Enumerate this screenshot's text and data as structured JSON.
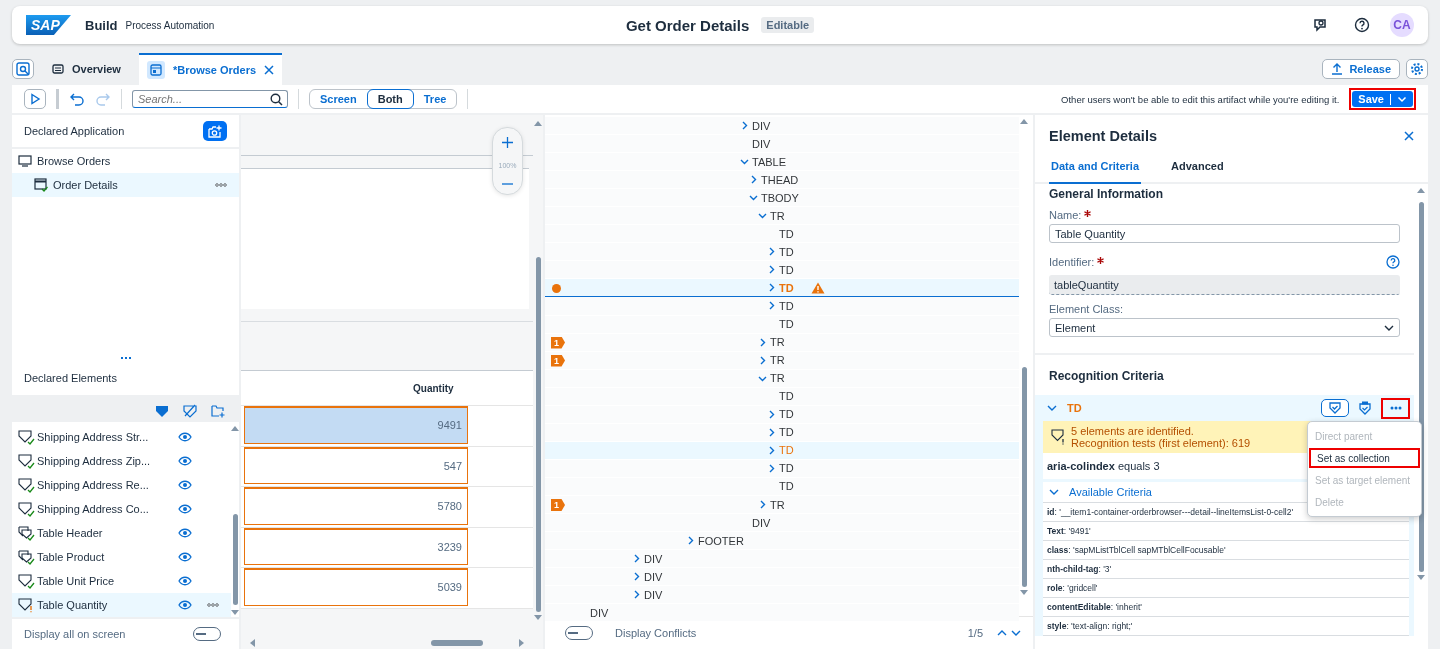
{
  "header": {
    "logo": "SAP",
    "product": "Build",
    "subtitle": "Process Automation",
    "title": "Get Order Details",
    "badge": "Editable",
    "avatar": "CA"
  },
  "tabs": [
    {
      "label": "Overview",
      "selected": false,
      "closable": false
    },
    {
      "label": "*Browse Orders",
      "selected": true,
      "closable": true
    }
  ],
  "release_button": "Release",
  "toolbar": {
    "search": {
      "placeholder": "Search..."
    },
    "redo_disabled": true,
    "views": [
      {
        "label": "Screen",
        "selected": false
      },
      {
        "label": "Both",
        "selected": true
      },
      {
        "label": "Tree",
        "selected": false
      }
    ],
    "notice": "Other users won't be able to edit this artifact while you're editing it.",
    "save": {
      "label": "Save",
      "annotated": true
    }
  },
  "declared_application": {
    "title": "Declared Application",
    "items": [
      {
        "label": "Browse Orders",
        "selected": false,
        "children": [
          {
            "label": "Order Details",
            "selected": true
          }
        ]
      }
    ]
  },
  "declared_elements": {
    "title": "Declared Elements",
    "items": [
      {
        "label": "Shipping Address Str...",
        "kind": "element",
        "recognized": true,
        "selected": false
      },
      {
        "label": "Shipping Address Zip...",
        "kind": "element",
        "recognized": true,
        "selected": false
      },
      {
        "label": "Shipping Address Re...",
        "kind": "element",
        "recognized": true,
        "selected": false
      },
      {
        "label": "Shipping Address Co...",
        "kind": "element",
        "recognized": true,
        "selected": false
      },
      {
        "label": "Table Header",
        "kind": "collection",
        "recognized": true,
        "selected": false
      },
      {
        "label": "Table Product",
        "kind": "collection",
        "recognized": true,
        "selected": false
      },
      {
        "label": "Table Unit Price",
        "kind": "element",
        "recognized": true,
        "selected": false
      },
      {
        "label": "Table Quantity",
        "kind": "element",
        "recognized": false,
        "selected": true
      }
    ],
    "display_all": {
      "label": "Display all on screen",
      "on": false
    }
  },
  "screen_preview": {
    "zoom": "100%",
    "column": "Quantity",
    "cells": [
      {
        "value": "9491",
        "selected": true
      },
      {
        "value": "547",
        "selected": false
      },
      {
        "value": "5780",
        "selected": false
      },
      {
        "value": "3239",
        "selected": false
      },
      {
        "value": "5039",
        "selected": false
      }
    ]
  },
  "dom_tree": {
    "nodes": [
      {
        "children": [
          {
            "children": [
              {
                "children": [
                  {
                    "label": "DIV",
                    "kind": "branch",
                    "expanded": false
                  },
                  {
                    "label": "DIV",
                    "kind": "leaf"
                  },
                  {
                    "label": "TABLE",
                    "kind": "branch",
                    "expanded": true,
                    "children": [
                      {
                        "label": "THEAD",
                        "kind": "branch",
                        "expanded": false
                      },
                      {
                        "label": "TBODY",
                        "kind": "branch",
                        "expanded": true,
                        "children": [
                          {
                            "label": "TR",
                            "kind": "branch",
                            "expanded": true,
                            "children": [
                              {
                                "label": "TD",
                                "kind": "leaf"
                              },
                              {
                                "label": "TD",
                                "kind": "branch",
                                "expanded": false
                              },
                              {
                                "label": "TD",
                                "kind": "branch",
                                "expanded": false
                              },
                              {
                                "label": "TD",
                                "kind": "branch",
                                "expanded": false,
                                "selected": true,
                                "conflict": true,
                                "warning": true
                              },
                              {
                                "label": "TD",
                                "kind": "branch",
                                "expanded": false
                              },
                              {
                                "label": "TD",
                                "kind": "leaf"
                              }
                            ]
                          },
                          {
                            "label": "TR",
                            "kind": "branch",
                            "expanded": false,
                            "badge": "1"
                          },
                          {
                            "label": "TR",
                            "kind": "branch",
                            "expanded": false,
                            "badge": "1"
                          },
                          {
                            "label": "TR",
                            "kind": "branch",
                            "expanded": true,
                            "children": [
                              {
                                "label": "TD",
                                "kind": "leaf"
                              },
                              {
                                "label": "TD",
                                "kind": "branch",
                                "expanded": false
                              },
                              {
                                "label": "TD",
                                "kind": "branch",
                                "expanded": false
                              },
                              {
                                "label": "TD",
                                "kind": "branch",
                                "expanded": false,
                                "matched": true
                              },
                              {
                                "label": "TD",
                                "kind": "branch",
                                "expanded": false
                              },
                              {
                                "label": "TD",
                                "kind": "leaf"
                              }
                            ]
                          },
                          {
                            "label": "TR",
                            "kind": "branch",
                            "expanded": false,
                            "badge": "1"
                          }
                        ]
                      }
                    ]
                  },
                  {
                    "label": "DIV",
                    "kind": "leaf"
                  }
                ]
              },
              {
                "label": "FOOTER",
                "kind": "branch",
                "expanded": false
              }
            ]
          },
          {
            "label": "DIV",
            "kind": "branch",
            "expanded": false
          },
          {
            "label": "DIV",
            "kind": "branch",
            "expanded": false
          },
          {
            "label": "DIV",
            "kind": "branch",
            "expanded": false
          }
        ]
      },
      {
        "label": "DIV",
        "kind": "leaf"
      }
    ],
    "display_conflicts": {
      "label": "Display Conflicts",
      "on": false
    },
    "pager": "1/5"
  },
  "details": {
    "title": "Element Details",
    "tabs": [
      {
        "label": "Data and Criteria",
        "selected": true
      },
      {
        "label": "Advanced",
        "selected": false
      }
    ],
    "general": {
      "title": "General Information",
      "name_label": "Name:",
      "name_value": "Table Quantity",
      "identifier_label": "Identifier:",
      "identifier_value": "tableQuantity",
      "class_label": "Element Class:",
      "class_value": "Element"
    },
    "recognition": {
      "title": "Recognition Criteria",
      "element": "TD",
      "expanded": true,
      "more_annotated": true,
      "message_line_1": "5 elements are identified.",
      "message_line_2": "Recognition tests (first element): 619",
      "criterion": "**aria-colindex** equals 3",
      "available_title": "Available Criteria",
      "available_expanded": true,
      "available": [
        "**id**: '__item1-container-orderbrowser---detail--lineItemsList-0-cell2'",
        "**Text**: '9491'",
        "**class**: 'sapMListTblCell sapMTblCellFocusable'",
        "**nth-child-tag**: '3'",
        "**role**: 'gridcell'",
        "**contentEditable**: 'inherit'",
        "**style**: 'text-align: right;'"
      ]
    },
    "menu": [
      {
        "label": "Direct parent",
        "disabled": true,
        "annotated": false
      },
      {
        "label": "Set as collection",
        "disabled": false,
        "annotated": true
      },
      {
        "label": "Set as target element",
        "disabled": true,
        "annotated": false
      },
      {
        "label": "Delete",
        "disabled": true,
        "annotated": false
      }
    ]
  }
}
